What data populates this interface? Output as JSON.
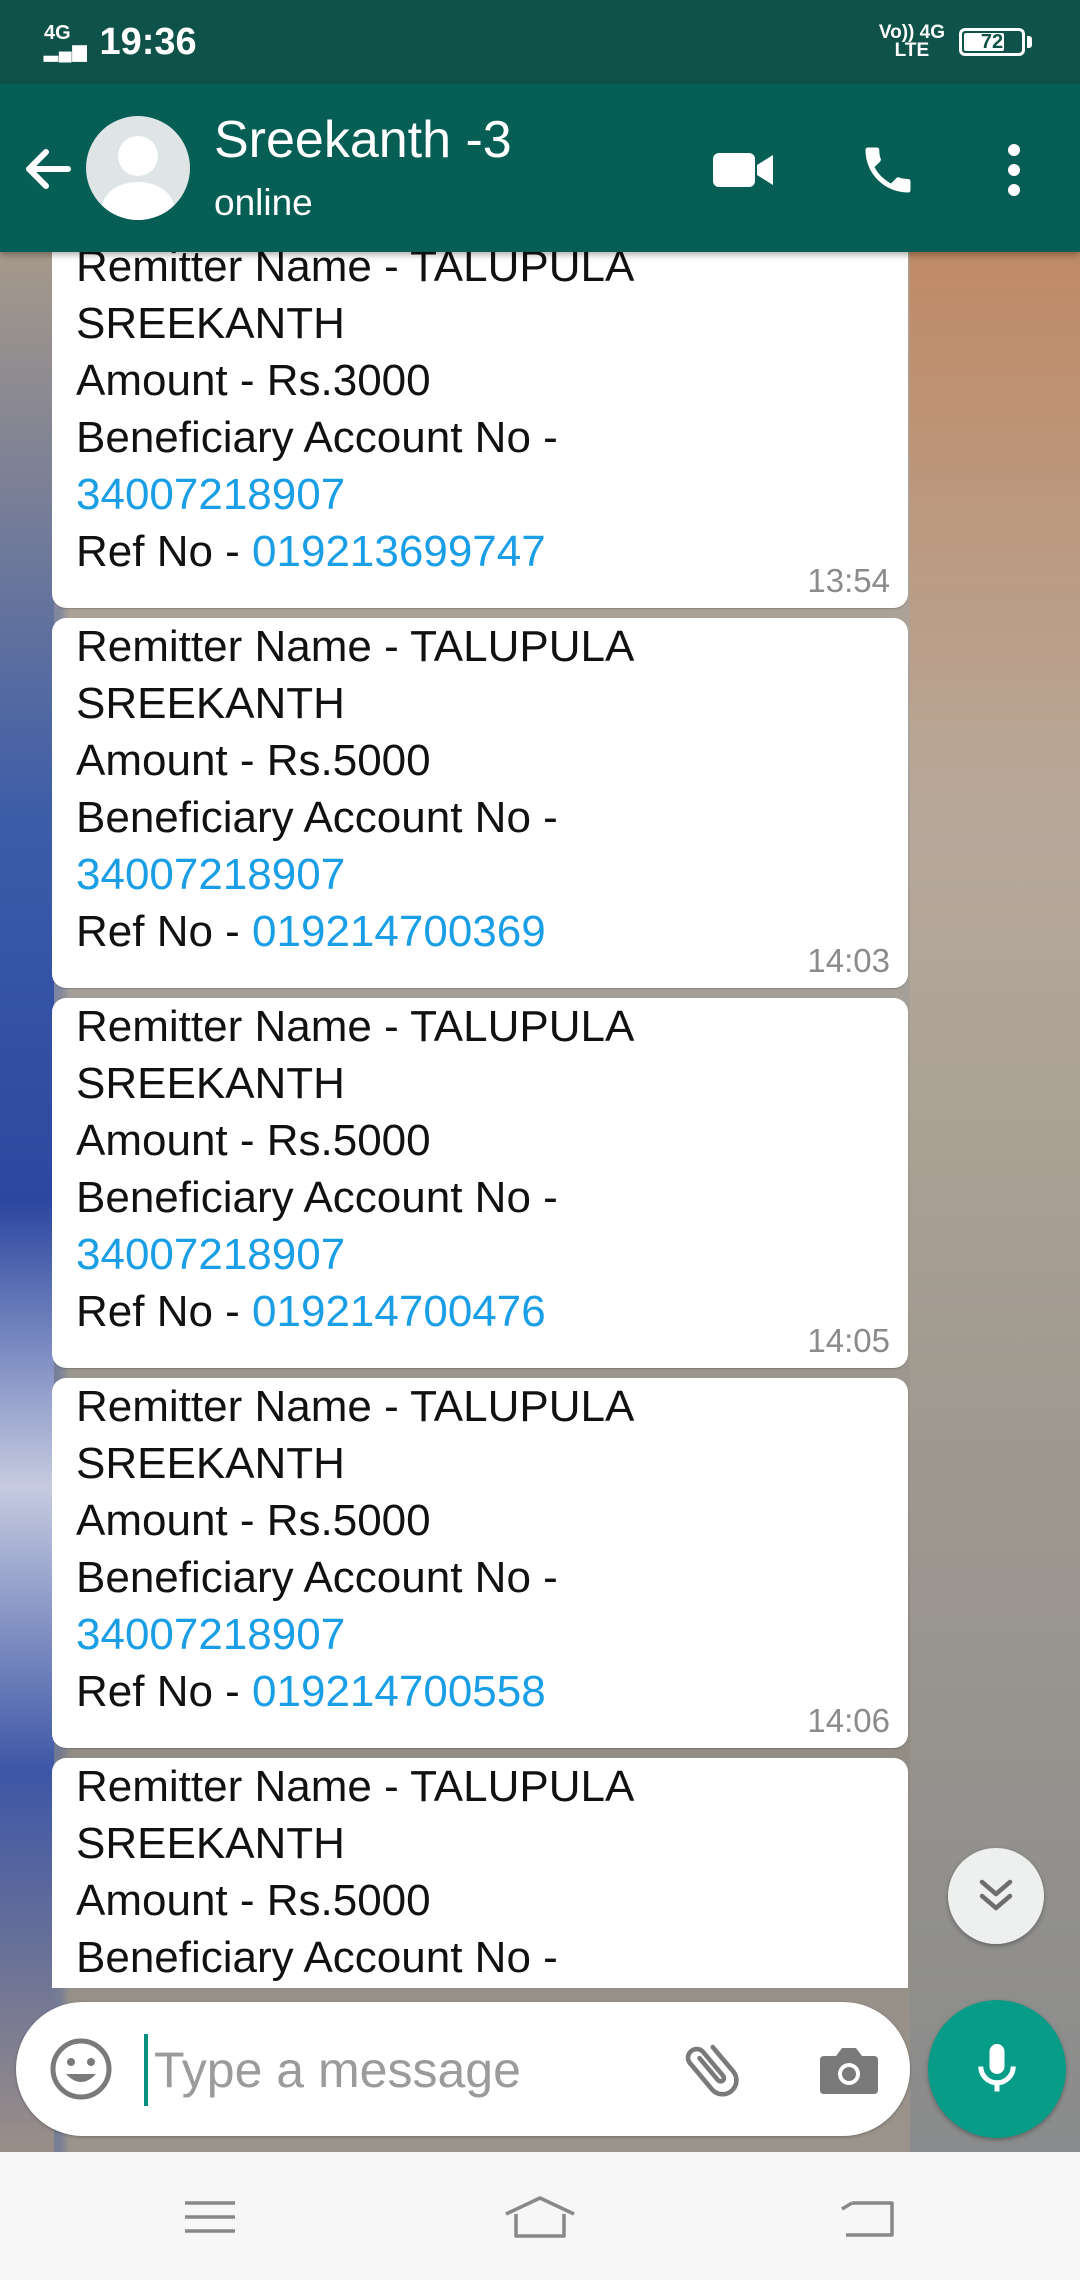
{
  "status_bar": {
    "network_type": "4G",
    "time": "19:36",
    "volte_label": "Vo)) 4G",
    "lte_label": "LTE",
    "battery_level": "72",
    "battery_fraction": 0.72
  },
  "header": {
    "contact_name": "Sreekanth -3",
    "contact_status": "online",
    "icons": [
      "back-arrow-icon",
      "video-call-icon",
      "voice-call-icon",
      "more-options-icon"
    ]
  },
  "messages": [
    {
      "remitter": "Remitter Name - TALUPULA",
      "remitter_cont": "SREEKANTH",
      "amount": "Amount - Rs.3000",
      "beneficiary_label": "Beneficiary Account No -",
      "account_no": "34007218907",
      "ref_label": "Ref No - ",
      "ref_no": "019213699747",
      "time": "13:54"
    },
    {
      "remitter": "Remitter Name - TALUPULA",
      "remitter_cont": "SREEKANTH",
      "amount": "Amount - Rs.5000",
      "beneficiary_label": "Beneficiary Account No -",
      "account_no": "34007218907",
      "ref_label": "Ref No - ",
      "ref_no": "019214700369",
      "time": "14:03"
    },
    {
      "remitter": "Remitter Name - TALUPULA",
      "remitter_cont": "SREEKANTH",
      "amount": "Amount - Rs.5000",
      "beneficiary_label": "Beneficiary Account No -",
      "account_no": "34007218907",
      "ref_label": "Ref No - ",
      "ref_no": "019214700476",
      "time": "14:05"
    },
    {
      "remitter": "Remitter Name - TALUPULA",
      "remitter_cont": "SREEKANTH",
      "amount": "Amount - Rs.5000",
      "beneficiary_label": "Beneficiary Account No -",
      "account_no": "34007218907",
      "ref_label": "Ref No - ",
      "ref_no": "019214700558",
      "time": "14:06"
    },
    {
      "remitter": "Remitter Name - TALUPULA",
      "remitter_cont": "SREEKANTH",
      "amount": "Amount - Rs.5000",
      "beneficiary_label": "Beneficiary Account No -",
      "account_no": "",
      "ref_label": "",
      "ref_no": "",
      "time": ""
    }
  ],
  "composer": {
    "placeholder": "Type a message",
    "value": "",
    "icons": [
      "emoji-icon",
      "attach-icon",
      "camera-icon",
      "mic-icon"
    ]
  },
  "nav": {
    "icons": [
      "menu-icon",
      "home-icon",
      "back-icon"
    ]
  },
  "colors": {
    "header": "#075e54",
    "status_bar": "#0f5249",
    "link": "#1a9ee6",
    "mic_button": "#079c88"
  }
}
